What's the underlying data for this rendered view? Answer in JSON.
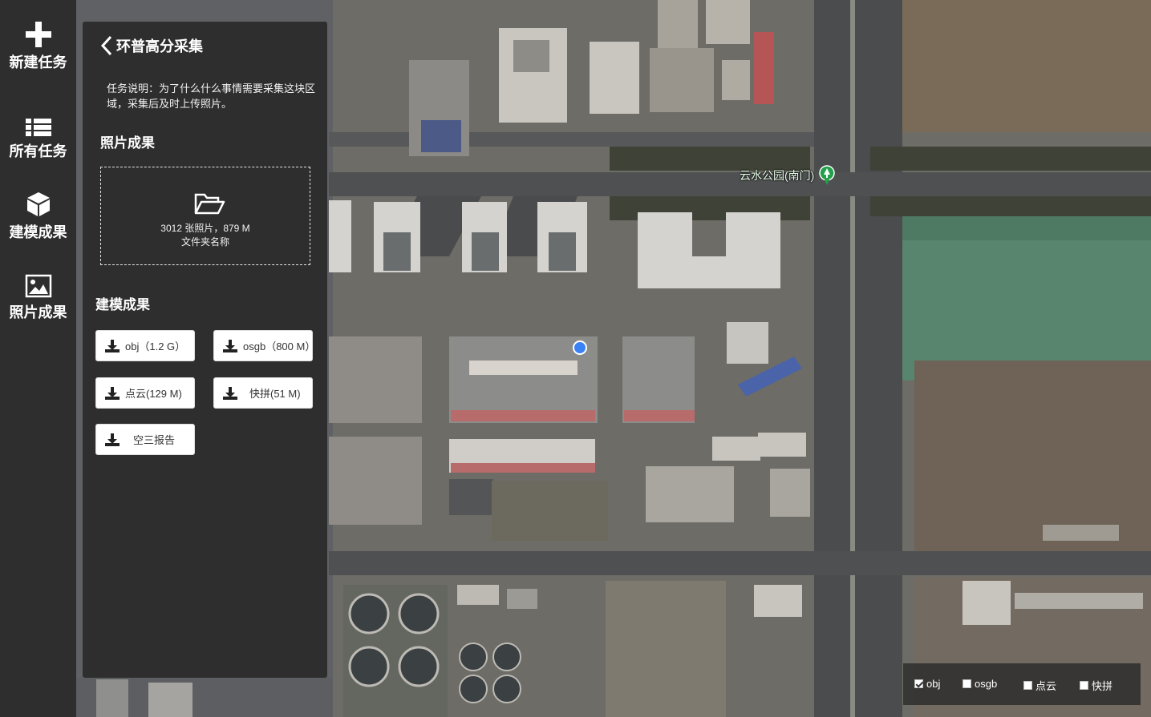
{
  "nav": {
    "items": [
      {
        "label": "新建任务",
        "icon": "plus-icon"
      },
      {
        "label": "所有任务",
        "icon": "list-icon"
      },
      {
        "label": "建模成果",
        "icon": "cube-icon"
      },
      {
        "label": "照片成果",
        "icon": "image-icon"
      }
    ]
  },
  "panel": {
    "back_icon": "chevron-left-icon",
    "title": "环普高分采集",
    "description": "任务说明：为了什么什么事情需要采集这块区域，采集后及时上传照片。",
    "photo_section_title": "照片成果",
    "photo_box": {
      "icon": "folder-open-icon",
      "stats": "3012 张照片，879 M",
      "folder_name": "文件夹名称"
    },
    "model_section_title": "建模成果",
    "downloads": [
      {
        "label": "obj（1.2 G）",
        "icon": "download-icon"
      },
      {
        "label": "osgb（800 M）",
        "icon": "download-icon"
      },
      {
        "label": "点云(129 M)",
        "icon": "download-icon"
      },
      {
        "label": "快拼(51 M)",
        "icon": "download-icon"
      },
      {
        "label": "空三报告",
        "icon": "download-icon"
      }
    ]
  },
  "map": {
    "poi_label": "云水公园(南门)",
    "poi_icon": "park-marker-icon"
  },
  "layers": {
    "items": [
      {
        "label": "obj",
        "checked": true
      },
      {
        "label": "osgb",
        "checked": false
      },
      {
        "label": "点云",
        "checked": false
      },
      {
        "label": "快拼",
        "checked": false
      }
    ]
  },
  "colors": {
    "panel_bg": "#2e2e2e",
    "location_dot": "#3b82f6",
    "poi_marker": "#22a04b"
  }
}
